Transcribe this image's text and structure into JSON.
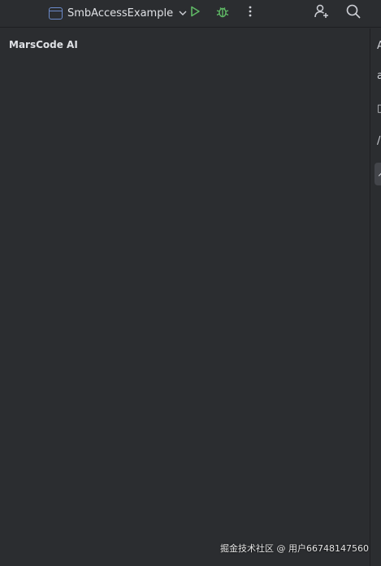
{
  "toolbar": {
    "run_config_name": "SmbAccessExample",
    "run_icon": "play-icon",
    "debug_icon": "bug-icon",
    "more_icon": "vertical-dots-icon",
    "add_user_icon": "add-user-icon",
    "search_icon": "search-icon"
  },
  "tool_window": {
    "title": "MarsCode AI"
  },
  "right_strip": {
    "icons": [
      "A",
      "a",
      "▯",
      "/",
      "↗"
    ]
  },
  "watermark": {
    "text": "掘金技术社区 @ 用户66748147560"
  },
  "colors": {
    "background": "#2b2d30",
    "text": "#dfe1e5",
    "run_green": "#5fb865",
    "config_blue": "#6b8ac9"
  }
}
